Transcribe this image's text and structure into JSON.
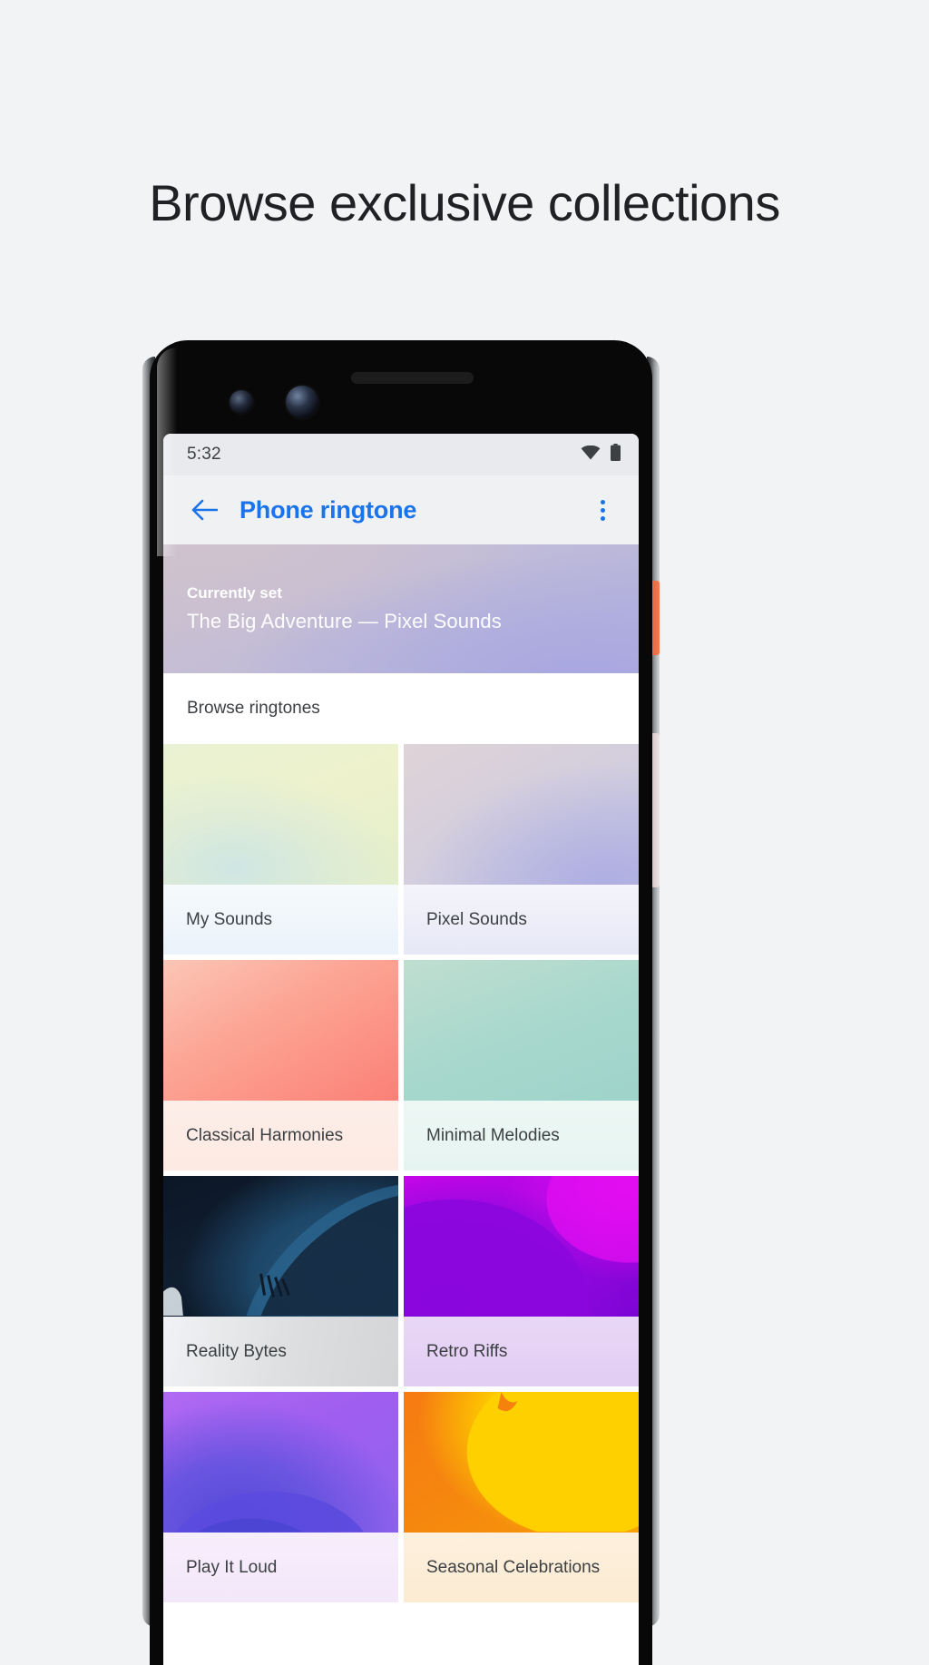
{
  "promo": {
    "headline": "Browse exclusive collections"
  },
  "phone": {
    "status_bar": {
      "time": "5:32",
      "icons": [
        "wifi-icon",
        "battery-icon"
      ]
    },
    "app_bar": {
      "back_icon": "arrow-back-icon",
      "title": "Phone ringtone",
      "overflow_icon": "more-vert-icon",
      "title_color": "#1a73e8"
    },
    "currently_set": {
      "label": "Currently set",
      "value": "The Big Adventure — Pixel Sounds"
    },
    "browse_header": "Browse ringtones",
    "grid": [
      {
        "label": "My Sounds",
        "art": "art-my-sounds",
        "labelbg": "lbl-my-sounds"
      },
      {
        "label": "Pixel Sounds",
        "art": "art-pixel-sounds",
        "labelbg": "lbl-pixel-sounds"
      },
      {
        "label": "Classical Harmonies",
        "art": "art-classical",
        "labelbg": "lbl-classical"
      },
      {
        "label": "Minimal Melodies",
        "art": "art-minimal",
        "labelbg": "lbl-minimal"
      },
      {
        "label": "Reality Bytes",
        "art": "art-reality",
        "labelbg": "lbl-reality"
      },
      {
        "label": "Retro Riffs",
        "art": "art-retro",
        "labelbg": "lbl-retro"
      },
      {
        "label": "Play It Loud",
        "art": "art-play-loud",
        "labelbg": "lbl-play-loud"
      },
      {
        "label": "Seasonal Celebrations",
        "art": "art-seasonal",
        "labelbg": "lbl-seasonal"
      }
    ],
    "hardware": {
      "power_button_color": "#ee6c42",
      "volume_button_color": "#e4d6d7"
    }
  },
  "page": {
    "background": "#f1f3f4"
  }
}
